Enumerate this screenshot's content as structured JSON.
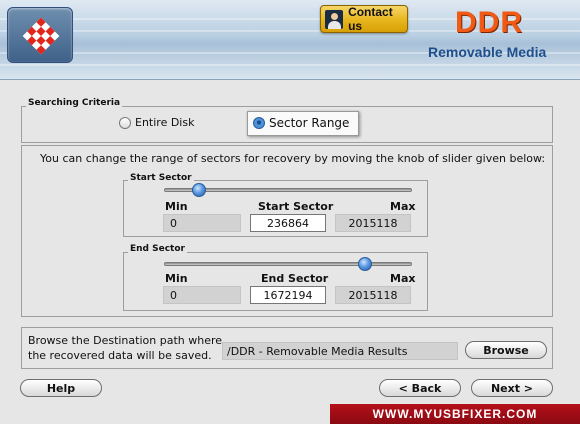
{
  "header": {
    "contact_label": "Contact us",
    "brand": "DDR",
    "product": "Removable Media"
  },
  "criteria": {
    "title": "Searching Criteria",
    "options": [
      {
        "label": "Entire Disk",
        "selected": false
      },
      {
        "label": "Sector Range",
        "selected": true
      }
    ]
  },
  "info_text": "You can change the range of sectors for recovery by moving the knob of slider given below:",
  "start_sector": {
    "title": "Start Sector",
    "min_label": "Min",
    "value_label": "Start Sector",
    "max_label": "Max",
    "min": "0",
    "value": "236864",
    "max": "2015118"
  },
  "end_sector": {
    "title": "End Sector",
    "min_label": "Min",
    "value_label": "End Sector",
    "max_label": "Max",
    "min": "0",
    "value": "1672194",
    "max": "2015118"
  },
  "destination": {
    "label_line1": "Browse the Destination path where",
    "label_line2": "the recovered data will be saved.",
    "path": "/DDR - Removable Media Results",
    "browse_label": "Browse"
  },
  "footer": {
    "help_label": "Help",
    "back_label": "< Back",
    "next_label": "Next >",
    "url": "WWW.MYUSBFIXER.COM"
  },
  "colors": {
    "brand": "#f05a14",
    "product": "#1e4f8c",
    "url_banner": "#b5101a"
  }
}
